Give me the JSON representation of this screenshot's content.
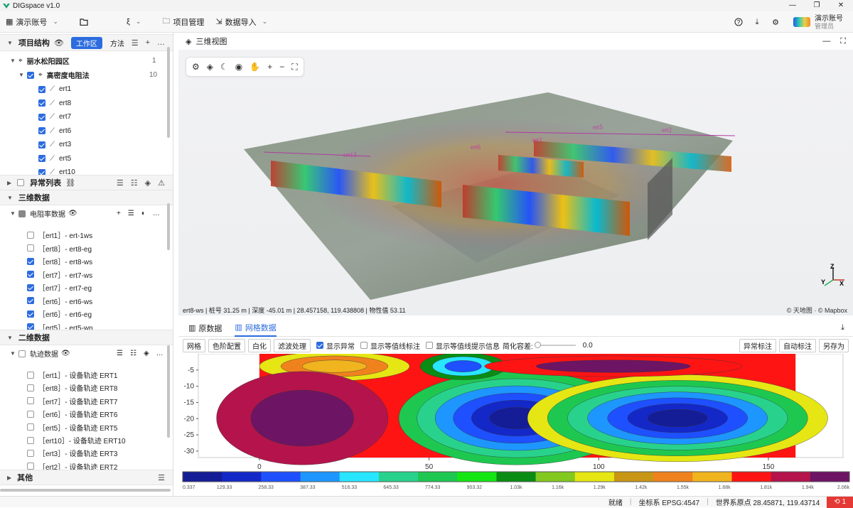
{
  "app": {
    "title": "DIGspace v1.0"
  },
  "menu": {
    "account": "演示账号",
    "folder_trail": "ξ",
    "project_mgmt": "项目管理",
    "data_import": "数据导入"
  },
  "user": {
    "name": "演示账号",
    "role": "管理员"
  },
  "project": {
    "title": "项目结构",
    "tab_workspace": "工作区",
    "tab_method": "方法",
    "root": {
      "label": "丽水松阳园区",
      "count": "1"
    },
    "method": {
      "label": "高密度电阻法",
      "count": "10"
    },
    "items": [
      "ert1",
      "ert8",
      "ert7",
      "ert6",
      "ert3",
      "ert5",
      "ert10"
    ]
  },
  "anomaly": {
    "title": "异常列表"
  },
  "data3d": {
    "title": "三维数据",
    "group": "电阻率数据",
    "items": [
      {
        "label": "［ert1］- ert-1ws",
        "checked": false
      },
      {
        "label": "［ert8］- ert8-eg",
        "checked": false
      },
      {
        "label": "［ert8］- ert8-ws",
        "checked": true
      },
      {
        "label": "［ert7］- ert7-ws",
        "checked": true
      },
      {
        "label": "［ert7］- ert7-eg",
        "checked": true
      },
      {
        "label": "［ert6］- ert6-ws",
        "checked": true
      },
      {
        "label": "［ert6］- ert6-eg",
        "checked": true
      },
      {
        "label": "［ert5］- ert5-wn",
        "checked": true
      }
    ]
  },
  "data2d": {
    "title": "二维数据",
    "group": "轨迹数据",
    "items": [
      "［ert1］- 设备轨迹 ERT1",
      "［ert8］- 设备轨迹 ERT8",
      "［ert7］- 设备轨迹 ERT7",
      "［ert6］- 设备轨迹 ERT6",
      "［ert5］- 设备轨迹 ERT5",
      "［ert10］- 设备轨迹 ERT10",
      "［ert3］- 设备轨迹 ERT3",
      "［ert2］- 设备轨迹 ERT2"
    ]
  },
  "other": {
    "title": "其他"
  },
  "view3d": {
    "title": "三维视图",
    "status": "ert8-ws | 桩号 31.25 m | 深度 -45.01 m | 28.457158, 119.438808 | 物性值 53.11",
    "credit": "© 天地图 · © Mapbox",
    "labels": [
      "ert13",
      "ert6",
      "ert1",
      "ert5",
      "ert2"
    ],
    "axis": {
      "z": "Z",
      "y": "Y",
      "x": "X"
    }
  },
  "panel": {
    "tab_raw": "原数据",
    "tab_grid": "网格数据",
    "btn_grid": "网格",
    "btn_colormap": "色阶配置",
    "btn_whiten": "白化",
    "btn_filter": "滤波处理",
    "show_anomaly": "显示异常",
    "show_contour_label": "显示等值线标注",
    "show_contour_tip": "显示等值线提示信息",
    "simplify": "简化容差:",
    "simplify_value": "0.0",
    "btn_anomaly_mark": "异常标注",
    "btn_auto_mark": "自动标注",
    "btn_save_as": "另存为"
  },
  "chart_data": {
    "type": "heatmap",
    "title": "",
    "xlabel": "",
    "ylabel": "",
    "xlim": [
      -18,
      172
    ],
    "ylim": [
      -32,
      0
    ],
    "x_ticks": [
      "0",
      "50",
      "100",
      "150"
    ],
    "y_ticks": [
      "-5",
      "-10",
      "-15",
      "-20",
      "-25",
      "-30"
    ],
    "data_x_range": [
      0,
      158
    ],
    "colorbar_labels": [
      "0.337",
      "129.33",
      "258.33",
      "387.33",
      "516.33",
      "645.33",
      "774.33",
      "903.32",
      "1.03k",
      "1.16k",
      "1.29k",
      "1.42k",
      "1.55k",
      "1.68k",
      "1.81k",
      "1.94k",
      "2.06k"
    ],
    "colorbar_colors": [
      "#141c96",
      "#1428c8",
      "#1e50ff",
      "#1e96ff",
      "#28e6ff",
      "#28d28c",
      "#1ec850",
      "#14e614",
      "#0a8c14",
      "#82c81e",
      "#e6e614",
      "#c89614",
      "#f0821e",
      "#f0b41e",
      "#ff1414",
      "#b4144b",
      "#6e1464"
    ]
  },
  "footer": {
    "ready": "就绪",
    "crs": "坐标系 EPSG:4547",
    "origin": "世界系原点 28.45871, 119.43714",
    "errors": "1"
  }
}
